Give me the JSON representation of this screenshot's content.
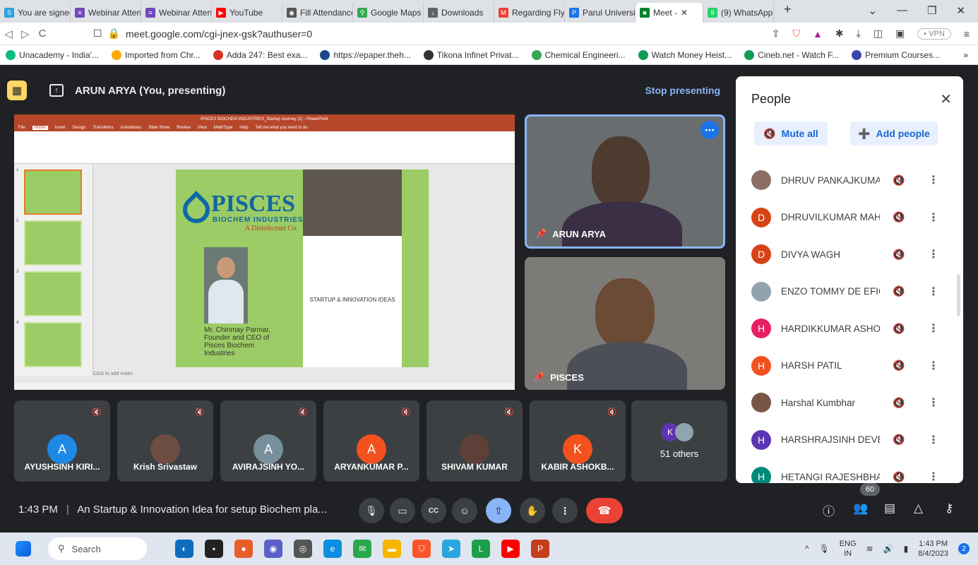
{
  "browser": {
    "tabs": [
      {
        "label": "You are signed",
        "color": "#2ca3e0",
        "glyph": "S"
      },
      {
        "label": "Webinar Atten",
        "color": "#7248b9",
        "glyph": "≡"
      },
      {
        "label": "Webinar Atten",
        "color": "#7248b9",
        "glyph": "≡"
      },
      {
        "label": "YouTube",
        "color": "#ff0000",
        "glyph": "▶"
      },
      {
        "label": "Fill Attendance",
        "color": "#555555",
        "glyph": "◉"
      },
      {
        "label": "Google Maps",
        "color": "#34a853",
        "glyph": "⚲"
      },
      {
        "label": "Downloads",
        "color": "#5f6368",
        "glyph": "↓"
      },
      {
        "label": "Regarding Flye",
        "color": "#ea4335",
        "glyph": "M"
      },
      {
        "label": "Parul Universit",
        "color": "#1a73e8",
        "glyph": "P"
      },
      {
        "label": "Meet - ",
        "color": "#00832d",
        "glyph": "■",
        "active": true
      },
      {
        "label": "(9) WhatsApp",
        "color": "#25d366",
        "glyph": "9"
      }
    ],
    "url": "meet.google.com/cgi-jnex-gsk?authuser=0",
    "vpn_label": "• VPN",
    "bookmarks": [
      {
        "label": "Unacademy - India'...",
        "color": "#08bd80"
      },
      {
        "label": "Imported from Chr...",
        "color": "#f9ab00"
      },
      {
        "label": "Adda 247: Best exa...",
        "color": "#d93025"
      },
      {
        "label": "https://epaper.theh...",
        "color": "#1a4a8a"
      },
      {
        "label": "Tikona Infinet Privat...",
        "color": "#333333"
      },
      {
        "label": "Chemical Engineeri...",
        "color": "#34a853"
      },
      {
        "label": "Watch Money Heist...",
        "color": "#0f9d58"
      },
      {
        "label": "Cineb.net - Watch F...",
        "color": "#0f9d58"
      },
      {
        "label": "Premium Courses...",
        "color": "#3949ab"
      }
    ]
  },
  "meet": {
    "presenter_label": "ARUN ARYA (You, presenting)",
    "stop_presenting": "Stop presenting",
    "slide": {
      "brand": "PISCES",
      "brand_sub": "BIOCHEM INDUSTRIES",
      "brand_tag": "A Disinfectant Co.",
      "founder": "Mr. Chinmay Parmar, Founder and CEO of Pisces Biochem Industries",
      "idea": "STARTUP & INNOVATION IDEAS",
      "ppt_title": "PISCES BIOCHEM INDUSTRIES_Startup Journey (1) - PowerPoint",
      "ppt_tabs": [
        "File",
        "Home",
        "Insert",
        "Design",
        "Transitions",
        "Animations",
        "Slide Show",
        "Review",
        "View",
        "MathType",
        "Help",
        "Tell me what you want to do"
      ],
      "notes": "Click to add notes"
    },
    "big_tiles": [
      {
        "name": "ARUN ARYA"
      },
      {
        "name": "PISCES"
      }
    ],
    "participants": [
      {
        "name": "AYUSHSINH KIRI...",
        "initial": "A",
        "color": "#1e88e5"
      },
      {
        "name": "Krish Srivastaw",
        "initial": "",
        "color": "#6d4c41"
      },
      {
        "name": "AVIRAJSINH YO...",
        "initial": "A",
        "color": "#78909c"
      },
      {
        "name": "ARYANKUMAR P...",
        "initial": "A",
        "color": "#f4511e"
      },
      {
        "name": "SHIVAM KUMAR",
        "initial": "",
        "color": "#5d4037"
      },
      {
        "name": "KABIR ASHOKB...",
        "initial": "K",
        "color": "#f4511e"
      }
    ],
    "others_label": "51 others",
    "others_initial": "K",
    "bottom": {
      "time": "1:43 PM",
      "title": "An Startup & Innovation Idea for setup Biochem pla...",
      "people_count": "60"
    }
  },
  "people_panel": {
    "title": "People",
    "mute_all": "Mute all",
    "add_people": "Add people",
    "rows": [
      {
        "name": "DHRUV PANKAJKUMAR ...",
        "initial": "",
        "color": "#8d6e63"
      },
      {
        "name": "DHRUVILKUMAR MAHE...",
        "initial": "D",
        "color": "#d84315"
      },
      {
        "name": "DIVYA WAGH",
        "initial": "D",
        "color": "#d84315"
      },
      {
        "name": "ENZO TOMMY DE EFIGE...",
        "initial": "",
        "color": "#90a4ae"
      },
      {
        "name": "HARDIKKUMAR ASHOK...",
        "initial": "H",
        "color": "#e91e63"
      },
      {
        "name": "HARSH PATIL",
        "initial": "H",
        "color": "#f4511e"
      },
      {
        "name": "Harshal Kumbhar",
        "initial": "",
        "color": "#795548"
      },
      {
        "name": "HARSHRAJSINH DEVEN...",
        "initial": "H",
        "color": "#5e35b1"
      },
      {
        "name": "HETANGI RAJESHBHAI ...",
        "initial": "H",
        "color": "#00897b"
      }
    ]
  },
  "taskbar": {
    "search": "Search",
    "lang": "ENG",
    "region": "IN",
    "time": "1:43 PM",
    "date": "8/4/2023",
    "notifications": "2"
  }
}
